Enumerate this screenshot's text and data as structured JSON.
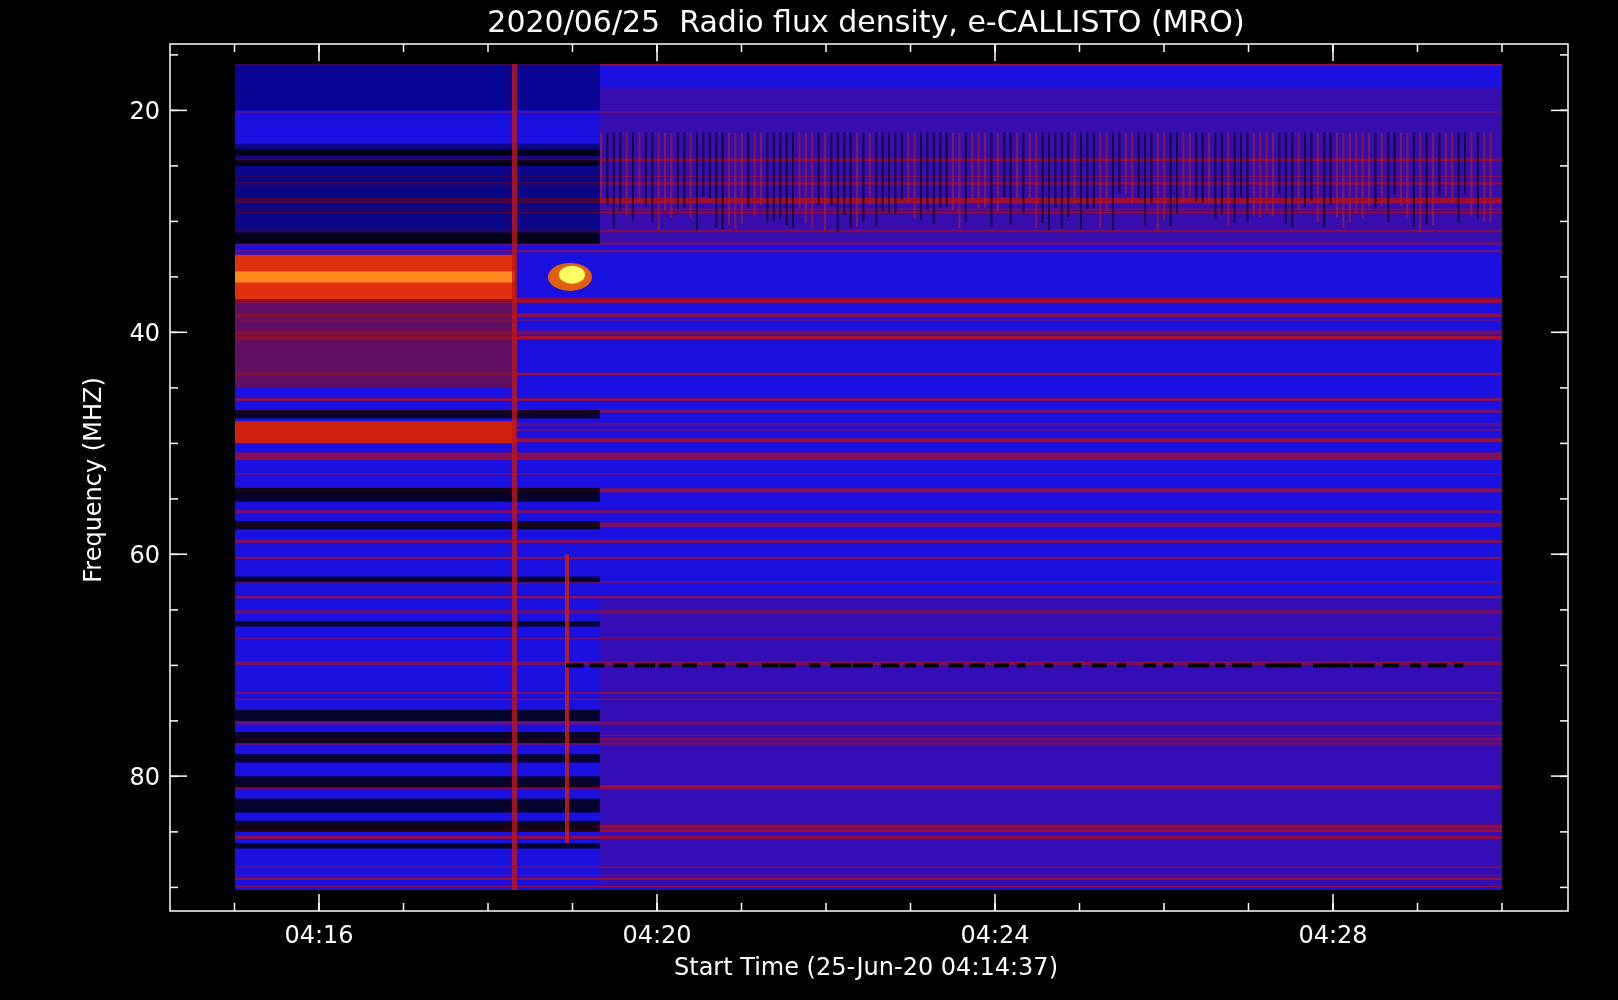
{
  "title": "2020/06/25  Radio flux density, e-CALLISTO (MRO)",
  "y_axis": {
    "label": "Frequency (MHZ)",
    "ticks": [
      "20",
      "40",
      "60",
      "80"
    ]
  },
  "x_axis": {
    "label": "Start Time (25-Jun-20 04:14:37)",
    "ticks": [
      "04:16",
      "04:20",
      "04:24",
      "04:28"
    ]
  }
}
